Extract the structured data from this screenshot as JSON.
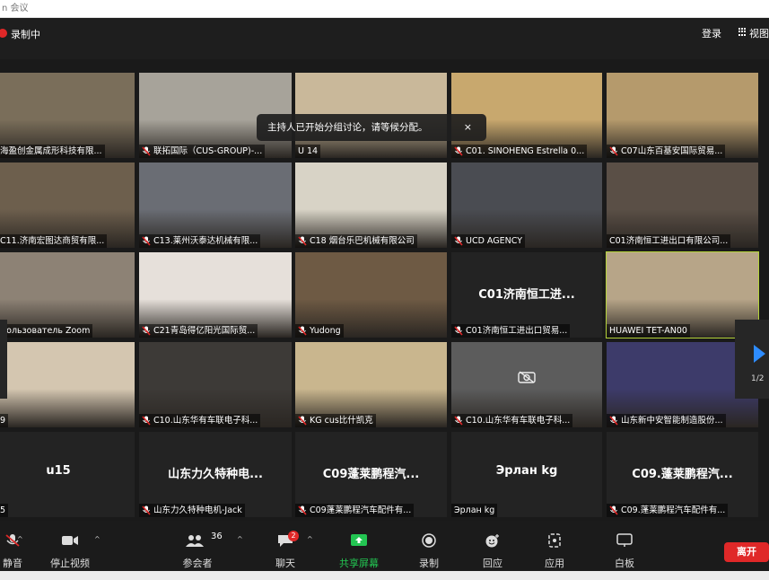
{
  "window": {
    "title": "n 会议"
  },
  "topbar": {
    "recording_label": "录制中",
    "login_label": "登录",
    "view_label": "视图"
  },
  "notification": {
    "text": "主持人已开始分组讨论，请等候分配。",
    "close_glyph": "×"
  },
  "pager": {
    "label": "1/2"
  },
  "tiles": [
    {
      "name": "海盈创金属成形科技有限...",
      "muted": false,
      "bg": "#7a6e5a"
    },
    {
      "name": "联拓国际（CUS-GROUP)-...",
      "muted": true,
      "bg": "#a7a39a"
    },
    {
      "name": "U 14",
      "muted": false,
      "bg": "#c9b89a"
    },
    {
      "name": "C01. SINOHENG Estrella 0...",
      "muted": true,
      "bg": "#c8a86e"
    },
    {
      "name": "C07山东百基安国际贸易...",
      "muted": true,
      "bg": "#b59a6c"
    },
    {
      "name": "C11.济南宏图达商贸有限...",
      "muted": false,
      "bg": "#6d5f4d"
    },
    {
      "name": "C13.莱州沃泰达机械有限...",
      "muted": true,
      "bg": "#6a6d74"
    },
    {
      "name": "C18 烟台乐巴机械有限公司",
      "muted": true,
      "bg": "#d8d3c6"
    },
    {
      "name": "UCD AGENCY",
      "muted": true,
      "bg": "#4a4c52"
    },
    {
      "name": "C01济南恒工进出口有限公司...",
      "muted": false,
      "bg": "#5a4f46"
    },
    {
      "name": "Пользователь Zoom",
      "muted": false,
      "bg": "#8d8275"
    },
    {
      "name": "C21青岛得亿阳光国际贸...",
      "muted": true,
      "bg": "#e6e0da"
    },
    {
      "name": "Yudong",
      "muted": true,
      "bg": "#6e5a44"
    },
    {
      "name": "C01济南恒工进出口贸易...",
      "muted": true,
      "center": "C01济南恒工进...",
      "bg": "#232323"
    },
    {
      "name": "HUAWEI TET-AN00",
      "muted": false,
      "bg": "#b7a588"
    },
    {
      "name": "9",
      "muted": false,
      "bg": "#d4c6b0"
    },
    {
      "name": "C10.山东华有车联电子科...",
      "muted": true,
      "bg": "#3d3a37"
    },
    {
      "name": "KG  cus比什凯克",
      "muted": true,
      "bg": "#c9b68e"
    },
    {
      "name": "C10.山东华有车联电子科...",
      "muted": true,
      "bg": "#5c5c5c"
    },
    {
      "name": "山东新中安智能制造股份...",
      "muted": true,
      "bg": "#3d3b6a"
    },
    {
      "name": "5",
      "muted": false,
      "center": "u15",
      "bg": "#232323"
    },
    {
      "name": "山东力久特种电机-Jack",
      "muted": true,
      "center": "山东力久特种电...",
      "bg": "#232323"
    },
    {
      "name": "C09蓬莱鹏程汽车配件有...",
      "muted": true,
      "center": "C09蓬莱鹏程汽...",
      "bg": "#232323"
    },
    {
      "name": "Эрлан kg",
      "muted": false,
      "center": "Эрлан kg",
      "bg": "#232323"
    },
    {
      "name": "C09.蓬莱鹏程汽车配件有...",
      "muted": true,
      "center": "C09.蓬莱鹏程汽...",
      "bg": "#232323"
    }
  ],
  "toolbar": {
    "mute": "静音",
    "video": "停止视频",
    "participants": "参会者",
    "participants_count": "36",
    "chat": "聊天",
    "chat_badge": "2",
    "share": "共享屏幕",
    "record": "录制",
    "reactions": "回应",
    "apps": "应用",
    "whiteboard": "白板",
    "leave": "离开",
    "caret": "^"
  },
  "colors": {
    "accent_share": "#23c552",
    "leave_red": "#e02828",
    "active_speaker": "#b5d33a",
    "nav_arrow": "#2d8cff"
  }
}
